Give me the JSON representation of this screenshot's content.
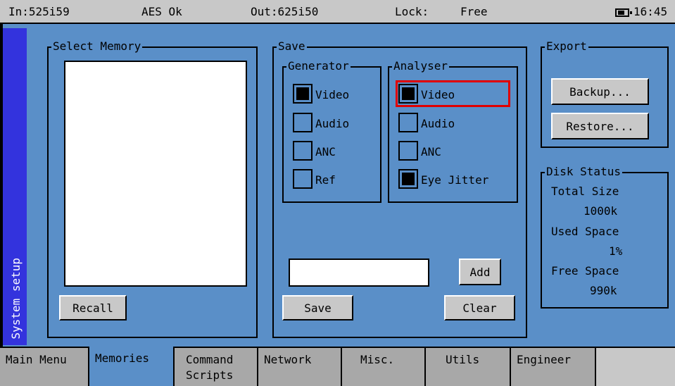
{
  "status": {
    "input": "In:525i59",
    "aes": "AES Ok",
    "output": "Out:625i50",
    "lock_label": "Lock:",
    "lock_value": "Free",
    "time": "16:45"
  },
  "side_tab": {
    "label": "System setup"
  },
  "select_memory": {
    "title": "Select Memory",
    "recall_label": "Recall"
  },
  "save": {
    "title": "Save",
    "generator": {
      "title": "Generator",
      "items": [
        {
          "label": "Video",
          "checked": true
        },
        {
          "label": "Audio",
          "checked": false
        },
        {
          "label": "ANC",
          "checked": false
        },
        {
          "label": "Ref",
          "checked": false
        }
      ]
    },
    "analyser": {
      "title": "Analyser",
      "items": [
        {
          "label": "Video",
          "checked": true
        },
        {
          "label": "Audio",
          "checked": false
        },
        {
          "label": "ANC",
          "checked": false
        },
        {
          "label": "Eye Jitter",
          "checked": true
        }
      ]
    },
    "name_value": "",
    "add_label": "Add",
    "save_label": "Save",
    "clear_label": "Clear"
  },
  "export": {
    "title": "Export",
    "backup_label": "Backup...",
    "restore_label": "Restore..."
  },
  "disk_status": {
    "title": "Disk Status",
    "total_size_label": "Total Size",
    "total_size_value": "1000k",
    "used_space_label": "Used Space",
    "used_space_value": "1%",
    "free_space_label": "Free Space",
    "free_space_value": "990k"
  },
  "tabs": [
    {
      "label": "Main Menu",
      "active": false
    },
    {
      "label": "Memories",
      "active": true
    },
    {
      "label": "Command Scripts",
      "active": false
    },
    {
      "label": "Network",
      "active": false
    },
    {
      "label": "Misc.",
      "active": false
    },
    {
      "label": "Utils",
      "active": false
    },
    {
      "label": "Engineer",
      "active": false
    }
  ],
  "colors": {
    "background": "#5a8fc8",
    "status_bar": "#c8c8c8",
    "side_tab": "#3333dd",
    "highlight": "#e00000"
  }
}
